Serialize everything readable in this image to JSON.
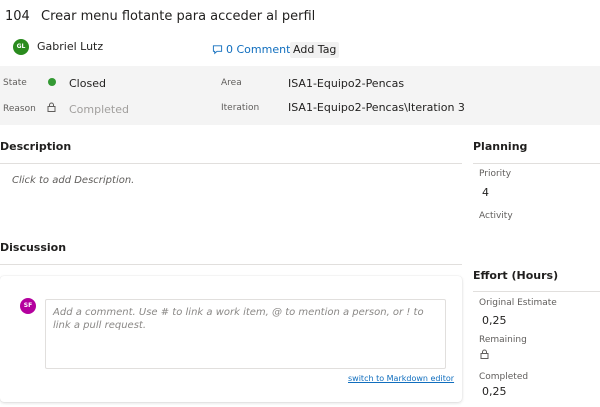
{
  "work_item": {
    "id": "104",
    "title": "Crear menu flotante para acceder al perfil"
  },
  "assignee": {
    "initials": "GL",
    "name": "Gabriel Lutz",
    "avatar_color": "#2a8b1e"
  },
  "header": {
    "comments_label": "0 Comments",
    "add_tag_label": "Add Tag"
  },
  "fields": {
    "state_label": "State",
    "state_value": "Closed",
    "state_color": "#339933",
    "reason_label": "Reason",
    "reason_value": "Completed",
    "area_label": "Area",
    "area_value": "ISA1-Equipo2-Pencas",
    "iteration_label": "Iteration",
    "iteration_value": "ISA1-Equipo2-Pencas\\Iteration 3"
  },
  "description": {
    "title": "Description",
    "placeholder": "Click to add Description."
  },
  "discussion": {
    "title": "Discussion",
    "user_initials": "SF",
    "user_avatar_color": "#b4009e",
    "comment_placeholder": "Add a comment. Use # to link a work item, @ to mention a person, or ! to link a pull request.",
    "markdown_link": "switch to Markdown editor"
  },
  "planning": {
    "title": "Planning",
    "priority_label": "Priority",
    "priority_value": "4",
    "activity_label": "Activity"
  },
  "effort": {
    "title": "Effort (Hours)",
    "original_estimate_label": "Original Estimate",
    "original_estimate_value": "0,25",
    "remaining_label": "Remaining",
    "completed_label": "Completed",
    "completed_value": "0,25"
  },
  "colors": {
    "link": "#106ebe",
    "band": "#f4f4f4"
  }
}
